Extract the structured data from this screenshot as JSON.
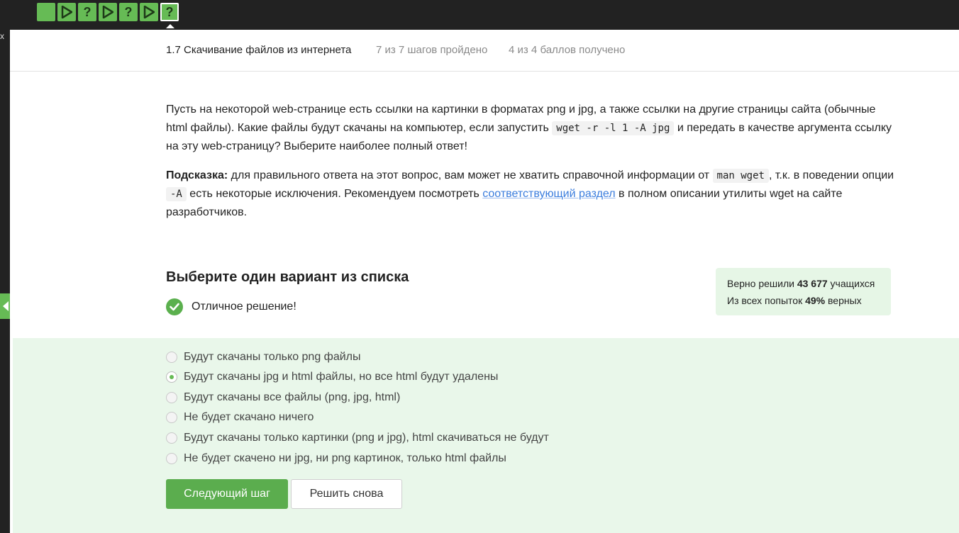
{
  "steps": [
    {
      "type": "text",
      "icon": "text-step-icon"
    },
    {
      "type": "video",
      "icon": "play-icon"
    },
    {
      "type": "quiz",
      "icon": "question-icon",
      "glyph": "?"
    },
    {
      "type": "video",
      "icon": "play-icon"
    },
    {
      "type": "quiz",
      "icon": "question-icon",
      "glyph": "?"
    },
    {
      "type": "video",
      "icon": "play-icon"
    },
    {
      "type": "quiz",
      "icon": "question-icon",
      "glyph": "?",
      "current": true
    }
  ],
  "colors": {
    "accent": "#66bb55",
    "dark_bar": "#222222",
    "answers_bg": "#e9f7ea",
    "stats_bg": "#e6f6e6",
    "link": "#3b7ddd"
  },
  "header": {
    "lesson_title": "1.7 Скачивание файлов из интернета",
    "steps_done": "7 из 7 шагов пройдено",
    "points": "4 из 4 баллов  получено"
  },
  "question": {
    "p1_before": "Пусть на некоторой web-странице есть ссылки на картинки в форматах png и jpg, а также ссылки на другие страницы сайта (обычные html файлы). Какие файлы будут скачаны на компьютер, если запустить ",
    "p1_code": "wget -r -l 1 -A jpg",
    "p1_after": " и передать в качестве аргумента ссылку на эту web-страницу? Выберите наиболее полный ответ!",
    "hint_label": "Подсказка:",
    "hint_text1": " для правильного ответа на этот вопрос, вам может не хватить справочной информации от ",
    "hint_code1": "man wget",
    "hint_text2": ", т.к. в поведении опции ",
    "hint_code2": "-A",
    "hint_text3": " есть некоторые исключения. Рекомендуем посмотреть ",
    "hint_link": "соответствующий раздел",
    "hint_text4": " в полном описании утилиты wget на сайте разработчиков."
  },
  "quiz": {
    "title": "Выберите один вариант из списка",
    "feedback": "Отличное решение!"
  },
  "stats": {
    "solved_prefix": "Верно решили ",
    "solved_count": "43 677",
    "solved_suffix": " учащихся",
    "attempts_prefix": "Из всех попыток ",
    "attempts_pct": "49%",
    "attempts_suffix": " верных"
  },
  "options": [
    {
      "label": "Будут скачаны только png файлы",
      "checked": false
    },
    {
      "label": "Будут скачаны jpg и html файлы, но все html будут удалены",
      "checked": true
    },
    {
      "label": "Будут скачаны все файлы (png, jpg, html)",
      "checked": false
    },
    {
      "label": "Не будет скачано ничего",
      "checked": false
    },
    {
      "label": "Будут скачаны только картинки (png и jpg), html скачиваться не будут",
      "checked": false
    },
    {
      "label": "Не будет скачено ни jpg, ни png картинок, только html файлы",
      "checked": false
    }
  ],
  "buttons": {
    "next": "Следующий шаг",
    "retry": "Решить снова"
  },
  "glyphs": {
    "close": "x"
  }
}
